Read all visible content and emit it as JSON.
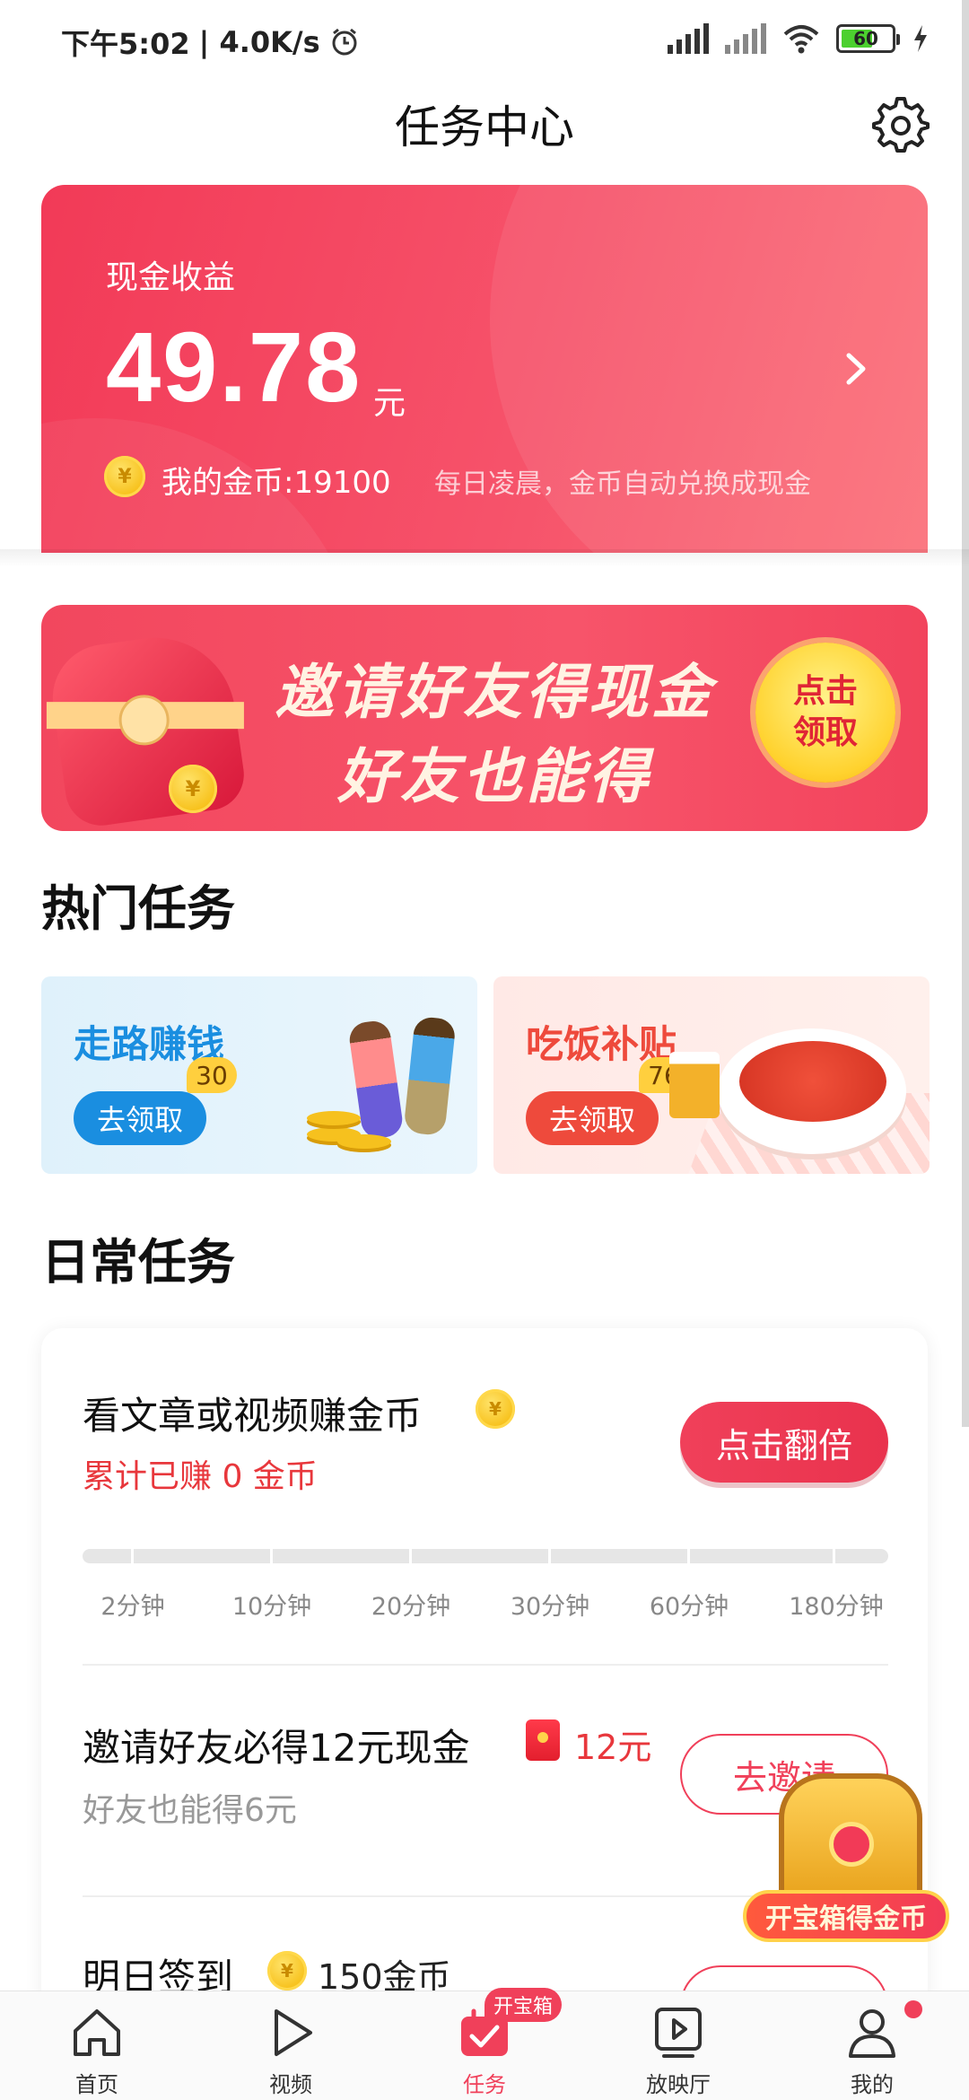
{
  "status_bar": {
    "time": "下午5:02",
    "speed": "| 4.0K/s",
    "battery": "60"
  },
  "header": {
    "title": "任务中心"
  },
  "earnings": {
    "label": "现金收益",
    "amount": "49.78",
    "unit": "元",
    "coin_symbol": "¥",
    "my_coins": "我的金币:19100",
    "note": "每日凌晨，金币自动兑换成现金"
  },
  "invite_banner": {
    "line1": "邀请好友得现金",
    "line2": "好友也能得",
    "claim_line1": "点击",
    "claim_line2": "领取"
  },
  "hot_section": {
    "title": "热门任务",
    "cards": [
      {
        "title": "走路赚钱",
        "badge": "30",
        "button": "去领取"
      },
      {
        "title": "吃饭补贴",
        "badge": "76",
        "button": "去领取"
      }
    ]
  },
  "daily_section": {
    "title": "日常任务",
    "tasks": [
      {
        "title": "看文章或视频赚金币",
        "subtitle": "累计已赚 0 金币",
        "button": "点击翻倍",
        "progress_fraction": 0,
        "progress_labels": [
          "2分钟",
          "10分钟",
          "20分钟",
          "30分钟",
          "60分钟",
          "180分钟"
        ]
      },
      {
        "title": "邀请好友必得12元现金",
        "reward": "12元",
        "subtitle": "好友也能得6元",
        "button": "去邀请"
      },
      {
        "title": "明日签到",
        "reward": "150金币"
      }
    ]
  },
  "floating_chest": {
    "label": "开宝箱得金币"
  },
  "bottom_nav": {
    "items": [
      {
        "label": "首页",
        "icon": "home-icon"
      },
      {
        "label": "视频",
        "icon": "play-icon"
      },
      {
        "label": "任务",
        "icon": "task-icon",
        "badge": "开宝箱"
      },
      {
        "label": "放映厅",
        "icon": "screen-icon"
      },
      {
        "label": "我的",
        "icon": "profile-icon"
      }
    ]
  },
  "colors": {
    "accent": "#f0405a",
    "earnings_card": "#f23a57",
    "walk_blue": "#1a8ee0",
    "eat_red": "#ee4a3c",
    "coin_gold": "#f7c11b"
  }
}
